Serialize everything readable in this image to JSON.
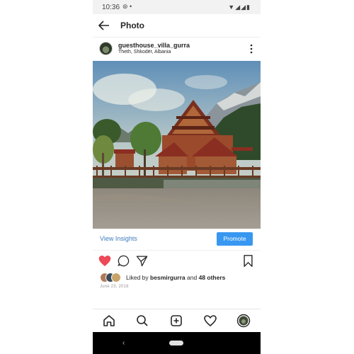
{
  "status_bar": {
    "time": "10:36"
  },
  "app_bar": {
    "title": "Photo"
  },
  "post": {
    "username": "guesthouse_villa_gurra",
    "location": "Theth, Shkodër, Albania",
    "image_alt": "Wooden chalet guesthouse with mountains",
    "liked": true
  },
  "insights": {
    "view_label": "View Insights",
    "promote_label": "Promote"
  },
  "likes": {
    "prefix": "Liked by",
    "user": "besmirgurra",
    "joiner": "and",
    "others": "48 others"
  },
  "date": "June 23, 2018",
  "colors": {
    "accent": "#3897f0",
    "heart": "#ed4956",
    "link": "#3e7bbd"
  },
  "bottom_nav": [
    "home-icon",
    "search-icon",
    "add-icon",
    "heart-icon",
    "profile-avatar"
  ]
}
